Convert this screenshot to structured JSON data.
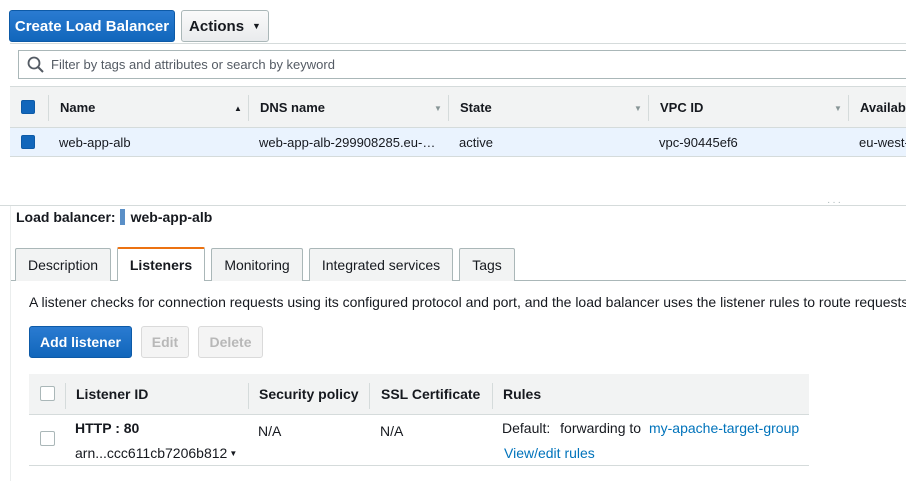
{
  "toolbar": {
    "create_label": "Create Load Balancer",
    "actions_label": "Actions"
  },
  "search": {
    "placeholder": "Filter by tags and attributes or search by keyword"
  },
  "table": {
    "columns": [
      "Name",
      "DNS name",
      "State",
      "VPC ID",
      "Availab"
    ],
    "rows": [
      {
        "name": "web-app-alb",
        "dns": "web-app-alb-299908285.eu-…",
        "state": "active",
        "vpc": "vpc-90445ef6",
        "az": "eu-west-"
      }
    ]
  },
  "detail": {
    "label": "Load balancer:",
    "name": "web-app-alb",
    "tabs": [
      "Description",
      "Listeners",
      "Monitoring",
      "Integrated services",
      "Tags"
    ],
    "active_tab": "Listeners"
  },
  "listeners": {
    "intro": "A listener checks for connection requests using its configured protocol and port, and the load balancer uses the listener rules to route requests",
    "add_label": "Add listener",
    "edit_label": "Edit",
    "delete_label": "Delete",
    "columns": [
      "Listener ID",
      "Security policy",
      "SSL Certificate",
      "Rules"
    ],
    "rows": [
      {
        "listener": "HTTP : 80",
        "arn": "arn...ccc611cb7206b812",
        "security_policy": "N/A",
        "ssl_certificate": "N/A",
        "rules_default": "Default:",
        "rules_action": "forwarding to",
        "rules_target": "my-apache-target-group",
        "rules_link": "View/edit rules"
      }
    ]
  },
  "colors": {
    "primary": "#1166bb",
    "link": "#0073bb",
    "tab_accent": "#ec7211",
    "selected_row": "#eaf3fe"
  }
}
